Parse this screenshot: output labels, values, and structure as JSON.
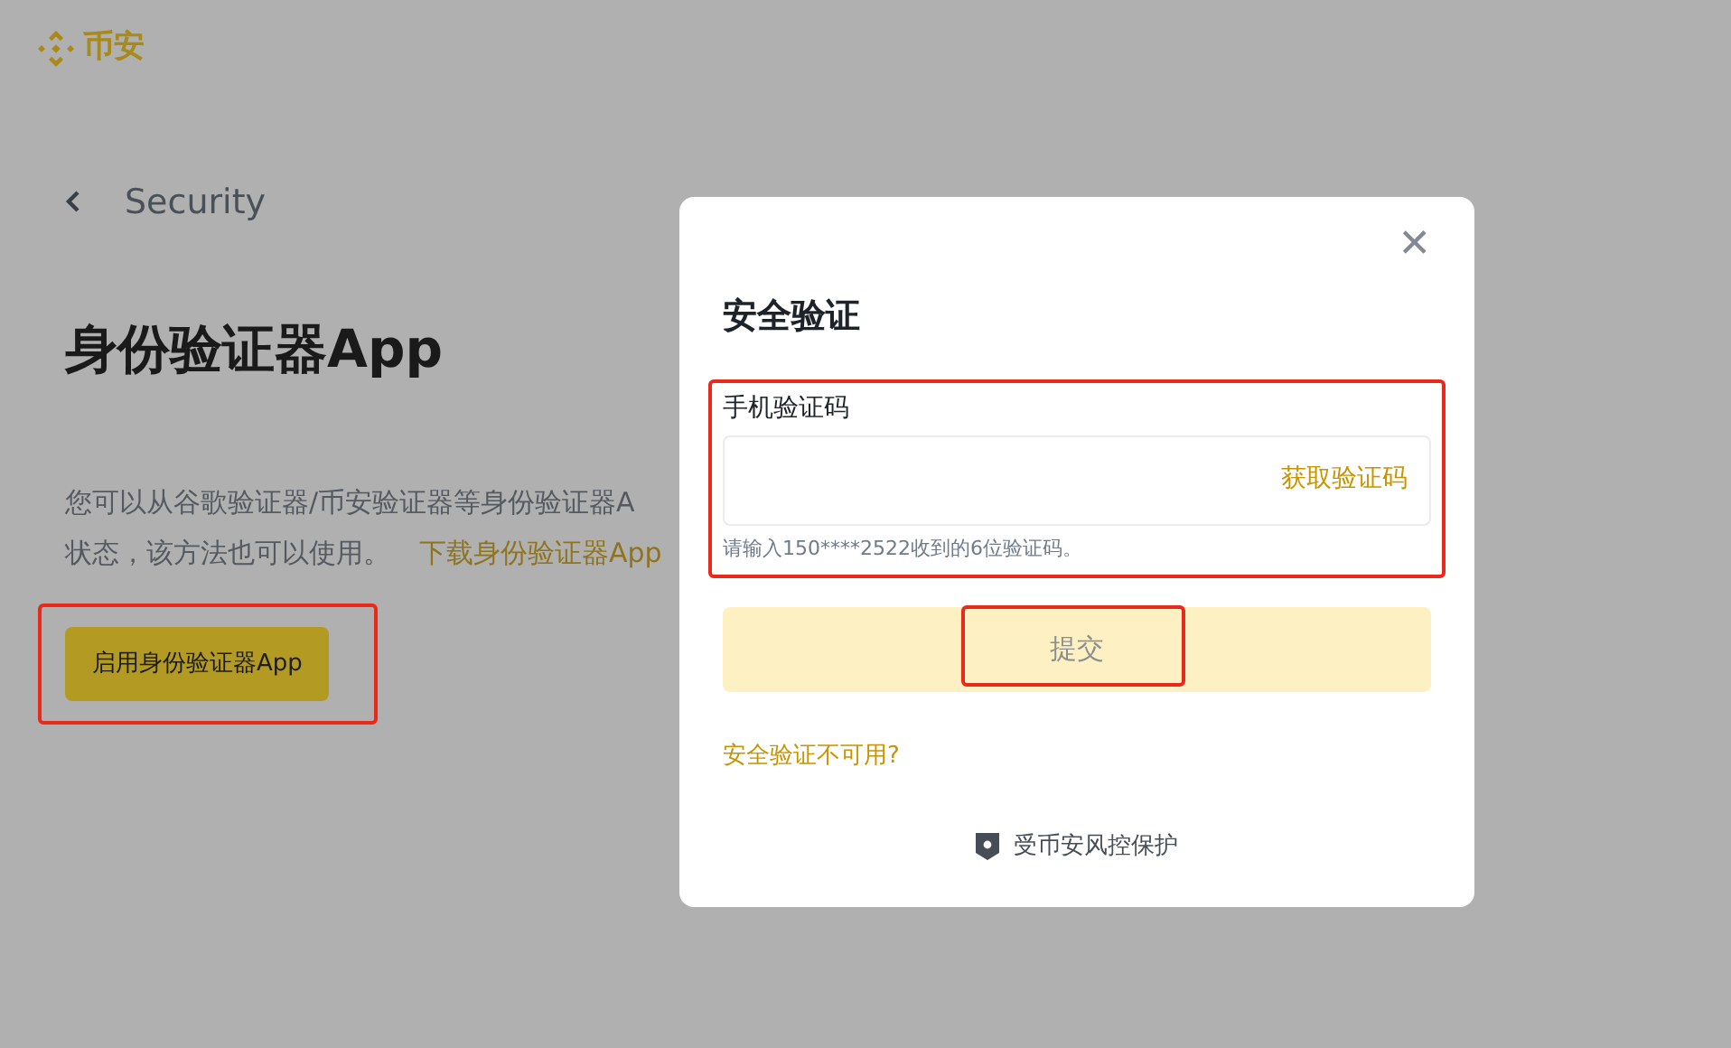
{
  "brand": {
    "name": "币安"
  },
  "back": {
    "label": "Security"
  },
  "page": {
    "title": "身份验证器App",
    "description_line_1": "您可以从谷歌验证器/币安验证器等身份验证器A",
    "description_line_2": "状态，该方法也可以使用。",
    "download_link": "下载身份验证器App",
    "enable_button": {
      "label": "启用身份验证器App",
      "highlighted": true
    }
  },
  "dialog": {
    "close": "✕",
    "title": "安全验证",
    "field": {
      "label": "手机验证码",
      "action": "获取验证码",
      "hint": "请输入150****2522收到的6位验证码。",
      "highlighted": true
    },
    "submit": {
      "label": "提交",
      "disabled": true,
      "highlighted": true
    },
    "unavailable_link": "安全验证不可用?",
    "footer": "受币安风控保护"
  }
}
